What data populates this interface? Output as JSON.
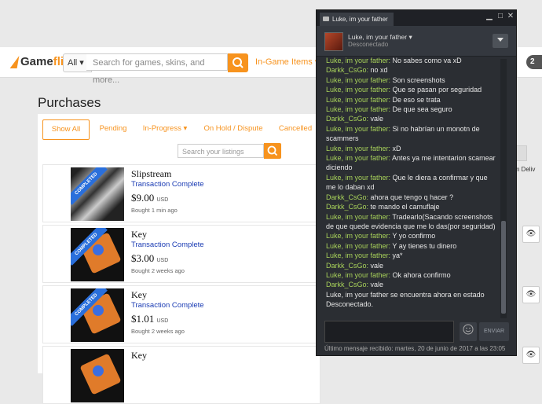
{
  "gameflip": {
    "brand_game": "Game",
    "brand_flip": "flip",
    "category_select": "All ▾",
    "search_placeholder": "Search for games, skins, and more...",
    "nav_ingame": "In-Game Items ▾",
    "notifications_count": "2",
    "page_title": "Purchases",
    "tabs": [
      "Show All",
      "Pending",
      "In-Progress ▾",
      "On Hold / Dispute",
      "Cancelled"
    ],
    "listings_search_placeholder": "Search your listings",
    "confirm_delivery_partial": "firm Deliv",
    "items": [
      {
        "name": "Slipstream",
        "status": "Transaction Complete",
        "price": "$9.00",
        "currency": "USD",
        "time": "Bought 1 min ago"
      },
      {
        "name": "Key",
        "status": "Transaction Complete",
        "price": "$3.00",
        "currency": "USD",
        "time": "Bought 2 weeks ago"
      },
      {
        "name": "Key",
        "status": "Transaction Complete",
        "price": "$1.01",
        "currency": "USD",
        "time": "Bought 2 weeks ago"
      },
      {
        "name": "Key"
      }
    ],
    "ribbon_label": "COMPLETED",
    "accent_color": "#f7931e",
    "status_color": "#1a3bb3"
  },
  "chat": {
    "tab_title": "Luke, im your father",
    "friend_name": "Luke, im your father ▾",
    "friend_status": "Desconectado",
    "messages": [
      {
        "who": "Luke, im your father",
        "text": "No sabes como va xD"
      },
      {
        "who": "Darkk_CsGo",
        "text": "no xd"
      },
      {
        "who": "Luke, im your father",
        "text": "Son screenshots"
      },
      {
        "who": "Luke, im your father",
        "text": "Que se pasan por seguridad"
      },
      {
        "who": "Luke, im your father",
        "text": "De eso se trata"
      },
      {
        "who": "Luke, im your father",
        "text": "De que sea seguro"
      },
      {
        "who": "Darkk_CsGo",
        "text": "vale"
      },
      {
        "who": "Luke, im your father",
        "text": "Si no habrían un monotn de scammers"
      },
      {
        "who": "Luke, im your father",
        "text": "xD"
      },
      {
        "who": "Luke, im your father",
        "text": "Antes ya me intentarion scamear diciendo"
      },
      {
        "who": "Luke, im your father",
        "text": "Que le diera a confirmar y que me lo daban xd"
      },
      {
        "who": "Darkk_CsGo",
        "text": "ahora que tengo q hacer ?"
      },
      {
        "who": "Darkk_CsGo",
        "text": "te mando el camuflaje"
      },
      {
        "who": "Luke, im your father",
        "text": "Tradearlo(Sacando screenshots de que quede evidencia que me lo das(por seguridad)"
      },
      {
        "who": "Luke, im your father",
        "text": "Y yo confirmo"
      },
      {
        "who": "Luke, im your father",
        "text": "Y ay tienes tu dinero"
      },
      {
        "who": "Luke, im your father",
        "text": "ya*"
      },
      {
        "who": "Darkk_CsGo",
        "text": "vale"
      },
      {
        "who": "Luke, im your father",
        "text": "Ok ahora confirmo"
      },
      {
        "who": "Darkk_CsGo",
        "text": "vale"
      }
    ],
    "system_message": "Luke, im your father se encuentra ahora en estado Desconectado.",
    "send_label": "ENVIAR",
    "last_message": "Último mensaje recibido: martes, 20 de junio de 2017 a las 23:05",
    "name_color": "#a8d25a"
  }
}
